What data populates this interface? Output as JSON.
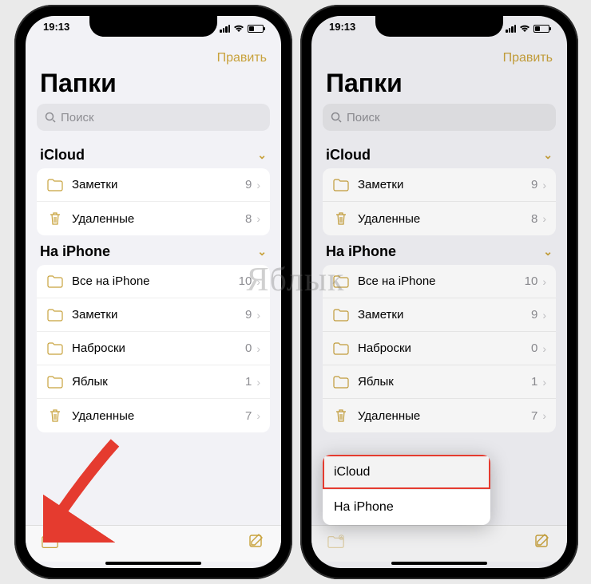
{
  "status": {
    "time": "19:13"
  },
  "nav": {
    "edit": "Править"
  },
  "title": "Папки",
  "search": {
    "placeholder": "Поиск"
  },
  "sections": [
    {
      "name": "iCloud",
      "items": [
        {
          "icon": "folder",
          "label": "Заметки",
          "count": "9"
        },
        {
          "icon": "trash",
          "label": "Удаленные",
          "count": "8"
        }
      ]
    },
    {
      "name": "На iPhone",
      "items": [
        {
          "icon": "folder",
          "label": "Все на iPhone",
          "count": "10"
        },
        {
          "icon": "folder",
          "label": "Заметки",
          "count": "9"
        },
        {
          "icon": "folder",
          "label": "Наброски",
          "count": "0"
        },
        {
          "icon": "folder",
          "label": "Яблык",
          "count": "1"
        },
        {
          "icon": "trash",
          "label": "Удаленные",
          "count": "7"
        }
      ]
    }
  ],
  "popup": {
    "options": [
      {
        "label": "iCloud",
        "highlighted": true
      },
      {
        "label": "На iPhone",
        "highlighted": false
      }
    ]
  },
  "watermark": "Яблык"
}
